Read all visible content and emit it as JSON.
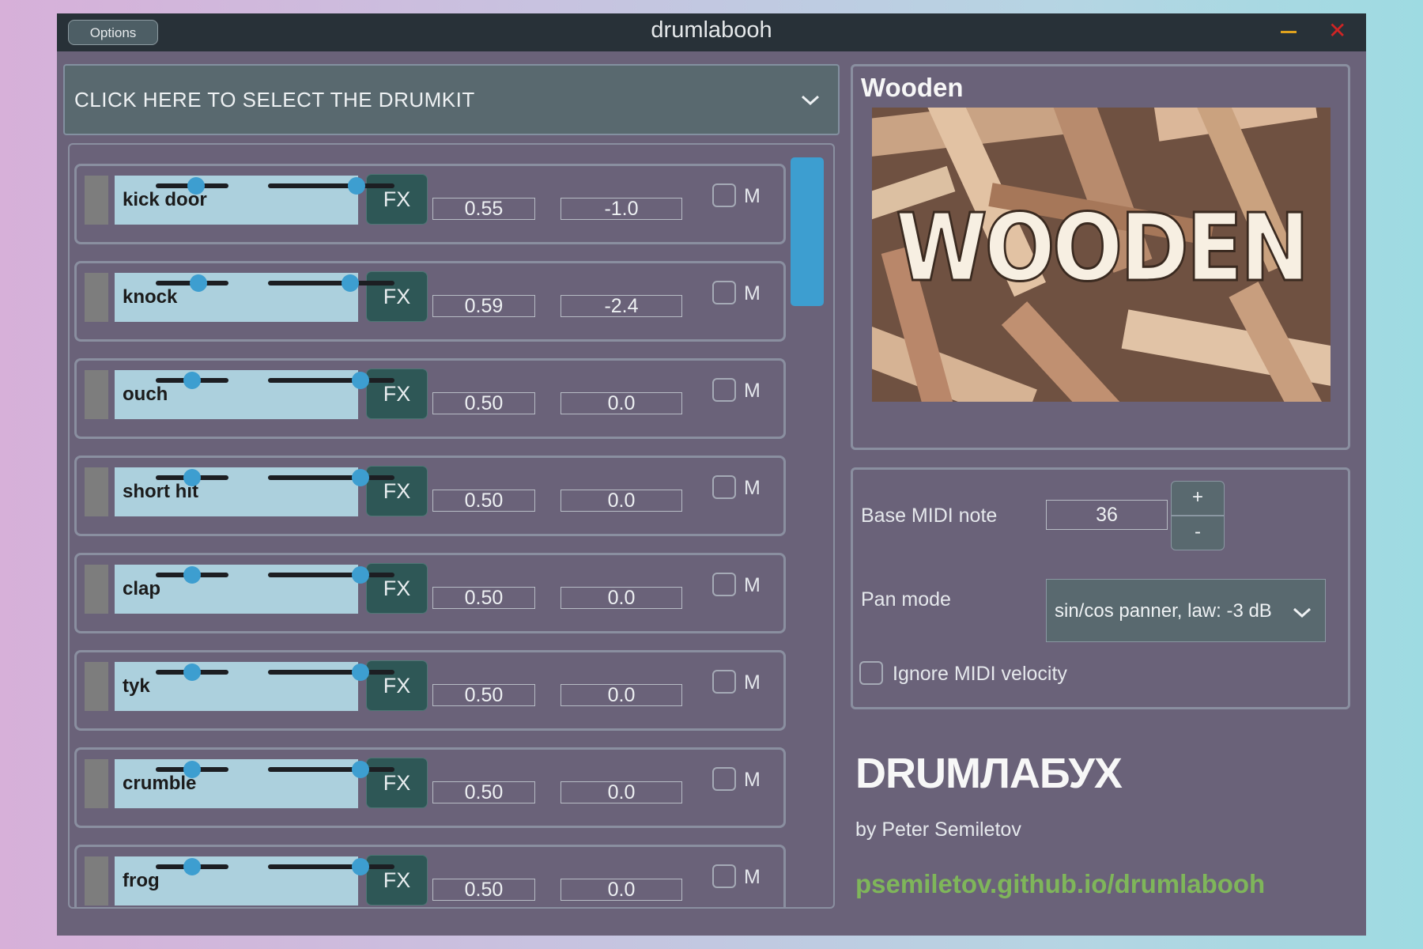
{
  "window": {
    "title": "drumlabooh",
    "options_label": "Options",
    "minimize_icon": "minimize-icon",
    "close_icon": "close-icon"
  },
  "drumkit_selector": {
    "label": "CLICK HERE TO SELECT THE DRUMKIT",
    "icon": "chevron-down-icon"
  },
  "colors": {
    "accent": "#3d9ed0",
    "fx_button": "#2e5756",
    "name_field": "#acd0dd",
    "link": "#7fb65a",
    "panel": "#6a6279"
  },
  "instruments": [
    {
      "name": "kick door",
      "fx_label": "FX",
      "gain": "0.55",
      "gain_level": 0.55,
      "pan": "-1.0",
      "pan_level": 0.7,
      "mute_label": "M"
    },
    {
      "name": "knock",
      "fx_label": "FX",
      "gain": "0.59",
      "gain_level": 0.59,
      "pan": "-2.4",
      "pan_level": 0.65,
      "mute_label": "M"
    },
    {
      "name": "ouch",
      "fx_label": "FX",
      "gain": "0.50",
      "gain_level": 0.5,
      "pan": "0.0",
      "pan_level": 0.73,
      "mute_label": "M"
    },
    {
      "name": "short hit",
      "fx_label": "FX",
      "gain": "0.50",
      "gain_level": 0.5,
      "pan": "0.0",
      "pan_level": 0.73,
      "mute_label": "M"
    },
    {
      "name": "clap",
      "fx_label": "FX",
      "gain": "0.50",
      "gain_level": 0.5,
      "pan": "0.0",
      "pan_level": 0.73,
      "mute_label": "M"
    },
    {
      "name": "tyk",
      "fx_label": "FX",
      "gain": "0.50",
      "gain_level": 0.5,
      "pan": "0.0",
      "pan_level": 0.73,
      "mute_label": "M"
    },
    {
      "name": "crumble",
      "fx_label": "FX",
      "gain": "0.50",
      "gain_level": 0.5,
      "pan": "0.0",
      "pan_level": 0.73,
      "mute_label": "M"
    },
    {
      "name": "frog",
      "fx_label": "FX",
      "gain": "0.50",
      "gain_level": 0.5,
      "pan": "0.0",
      "pan_level": 0.73,
      "mute_label": "M"
    }
  ],
  "kit_preview": {
    "name": "Wooden",
    "image_text": "WOODEN"
  },
  "settings": {
    "base_midi_label": "Base MIDI note",
    "base_midi_value": "36",
    "increment_label": "+",
    "decrement_label": "-",
    "pan_mode_label": "Pan mode",
    "pan_mode_value": "sin/cos panner, law: -3 dB",
    "ignore_velocity_label": "Ignore MIDI velocity"
  },
  "about": {
    "brand": "DRUMЛАБУХ",
    "author": "by Peter Semiletov",
    "link": "psemiletov.github.io/drumlabooh"
  }
}
